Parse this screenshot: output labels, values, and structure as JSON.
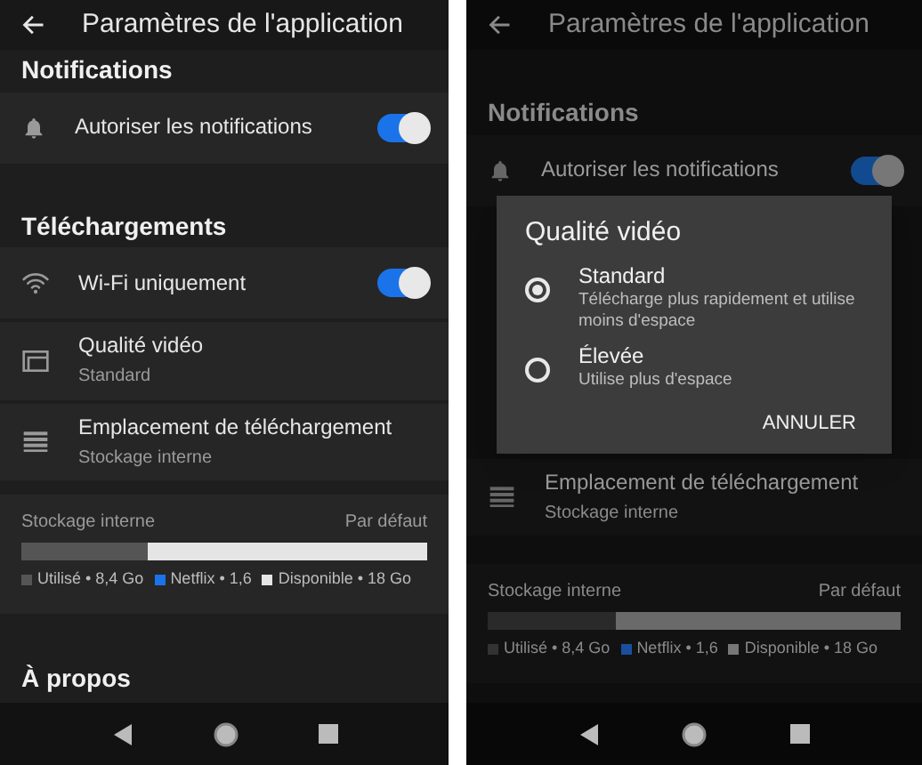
{
  "screens": [
    {
      "title": "Paramètres de l'application",
      "sections": [
        {
          "heading": "Notifications",
          "rows": [
            {
              "kind": "toggle",
              "label": "Autoriser les notifications",
              "on": true
            }
          ]
        },
        {
          "heading": "Téléchargements",
          "rows": [
            {
              "kind": "toggle",
              "label": "Wi-Fi uniquement",
              "on": true
            },
            {
              "kind": "detail",
              "label": "Qualité vidéo",
              "value": "Standard"
            },
            {
              "kind": "detail",
              "label": "Emplacement de téléchargement",
              "value": "Stockage interne"
            }
          ]
        }
      ],
      "storage": {
        "label": "Stockage interne",
        "default": "Par défaut",
        "level": 0.31,
        "legend": [
          {
            "text": "Utilisé • 8,4 Go",
            "color": "#555555"
          },
          {
            "text": "Netflix • 1,6",
            "color": "#1a73e8"
          },
          {
            "text": "Disponible • 18 Go",
            "color": "#e5e5e5"
          }
        ]
      },
      "footer_heading": "À propos"
    },
    {
      "title": "Paramètres de l'application",
      "sections": [
        {
          "heading": "Notifications",
          "rows": [
            {
              "kind": "toggle",
              "label": "Autoriser les notifications",
              "on": true
            }
          ]
        },
        {
          "rows": [
            {
              "kind": "detail",
              "label": "Emplacement de téléchargement",
              "value": "Stockage interne"
            }
          ]
        }
      ],
      "storage": {
        "label": "Stockage interne",
        "default": "Par défaut",
        "level": 0.31,
        "legend": [
          {
            "text": "Utilisé • 8,4 Go",
            "color": "#333333"
          },
          {
            "text": "Netflix • 1,6",
            "color": "#1a4f9e"
          },
          {
            "text": "Disponible • 18 Go",
            "color": "#777777"
          }
        ]
      },
      "dialog": {
        "title": "Qualité vidéo",
        "options": [
          {
            "label": "Standard",
            "description": "Télécharge plus rapidement et utilise moins d'espace",
            "selected": true
          },
          {
            "label": "Élevée",
            "description": "Utilise plus d'espace",
            "selected": false
          }
        ],
        "cancel": "ANNULER"
      }
    }
  ]
}
